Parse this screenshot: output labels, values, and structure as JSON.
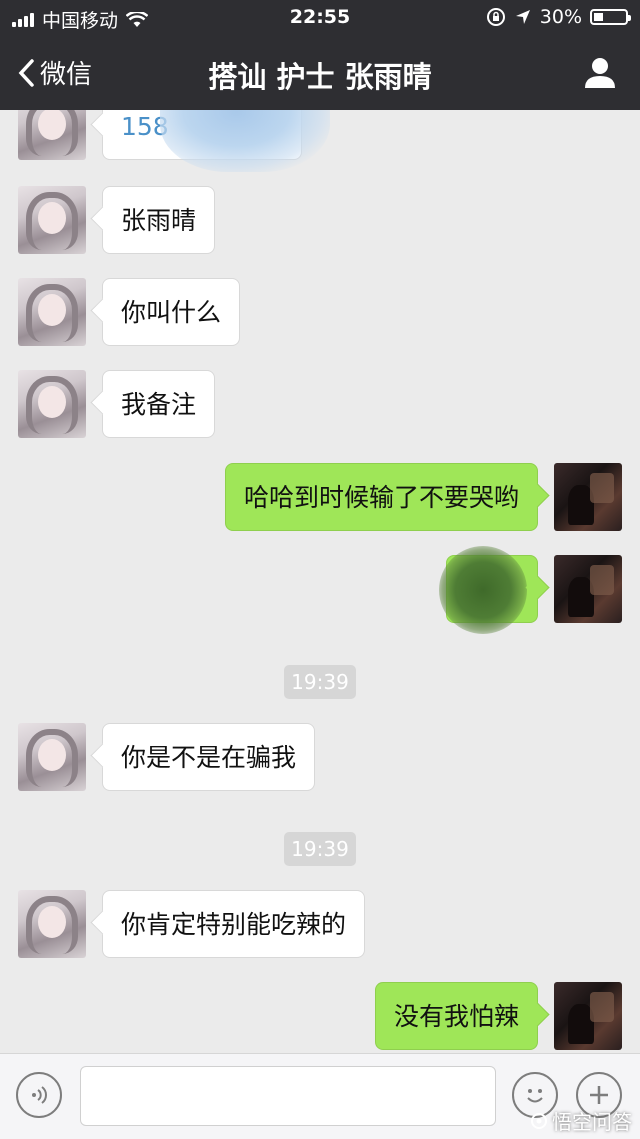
{
  "status_bar": {
    "carrier": "中国移动",
    "time": "22:55",
    "battery_percent": "30%",
    "battery_level": 0.3
  },
  "nav": {
    "back_label": "微信",
    "title": "搭讪 护士 张雨晴"
  },
  "messages": [
    {
      "side": "in",
      "text": "158",
      "kind": "phone-redacted"
    },
    {
      "side": "in",
      "text": "张雨晴"
    },
    {
      "side": "in",
      "text": "你叫什么"
    },
    {
      "side": "in",
      "text": "我备注"
    },
    {
      "side": "out",
      "text": "哈哈到时候输了不要哭哟"
    },
    {
      "side": "out",
      "text": "",
      "kind": "redacted"
    },
    {
      "timestamp": "19:39"
    },
    {
      "side": "in",
      "text": "你是不是在骗我"
    },
    {
      "timestamp": "19:39"
    },
    {
      "side": "in",
      "text": "你肯定特别能吃辣的"
    },
    {
      "side": "out",
      "text": "没有我怕辣"
    }
  ],
  "input_bar": {
    "placeholder": "",
    "icons": [
      "voice-icon",
      "emoji-icon",
      "plus-icon"
    ]
  },
  "watermark": "悟空问答"
}
